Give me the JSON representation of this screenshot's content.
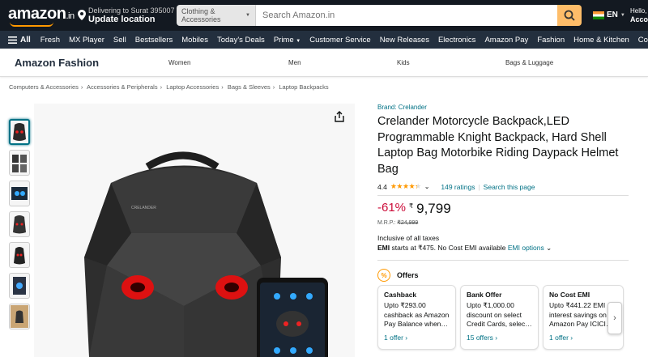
{
  "header": {
    "logo_text": "amazon",
    "logo_suffix": ".in",
    "deliver_line1": "Delivering to Surat 395007",
    "deliver_line2": "Update location",
    "search_category": "Clothing & Accessories",
    "search_placeholder": "Search Amazon.in",
    "language": "EN",
    "hello_line1": "Hello,",
    "hello_line2": "Accou"
  },
  "nav": {
    "all_label": "All",
    "items": [
      "Fresh",
      "MX Player",
      "Sell",
      "Bestsellers",
      "Mobiles",
      "Today's Deals",
      "Prime",
      "Customer Service",
      "New Releases",
      "Electronics",
      "Amazon Pay",
      "Fashion",
      "Home & Kitchen",
      "Compute"
    ]
  },
  "fashion": {
    "title": "Amazon Fashion",
    "categories": [
      "Women",
      "Men",
      "Kids",
      "Bags & Luggage"
    ]
  },
  "breadcrumb": [
    "Computers & Accessories",
    "Accessories & Peripherals",
    "Laptop Accessories",
    "Bags & Sleeves",
    "Laptop Backpacks"
  ],
  "product": {
    "brand": "Brand: Crelander",
    "title": "Crelander Motorcycle Backpack,LED Programmable Knight Backpack, Hard Shell Laptop Bag Motorbike Riding Daypack Helmet Bag",
    "rating": "4.4",
    "ratings_count": "149 ratings",
    "search_link": "Search this page",
    "discount": "-61%",
    "currency": "₹",
    "price": "9,799",
    "mrp_label": "M.R.P.:",
    "mrp": "₹24,999",
    "taxes": "Inclusive of all taxes",
    "emi_label": "EMI",
    "emi_text": "starts at ₹475. No Cost EMI available",
    "emi_link": "EMI options",
    "image_brand_text": "CRELANDER"
  },
  "offers": {
    "heading": "Offers",
    "cards": [
      {
        "title": "Cashback",
        "desc": "Upto ₹293.00 cashback as Amazon Pay Balance when…",
        "link": "1 offer ›"
      },
      {
        "title": "Bank Offer",
        "desc": "Upto ₹1,000.00 discount on select Credit Cards, selec…",
        "link": "15 offers ›"
      },
      {
        "title": "No Cost EMI",
        "desc": "Upto ₹441.22 EMI interest savings on Amazon Pay ICICI…",
        "link": "1 offer ›"
      }
    ]
  },
  "colors": {
    "nav_dark": "#131921",
    "nav_secondary": "#232f3e",
    "accent_orange": "#febd69",
    "link": "#007185",
    "discount_red": "#cc0c39",
    "star": "#ff9900"
  }
}
